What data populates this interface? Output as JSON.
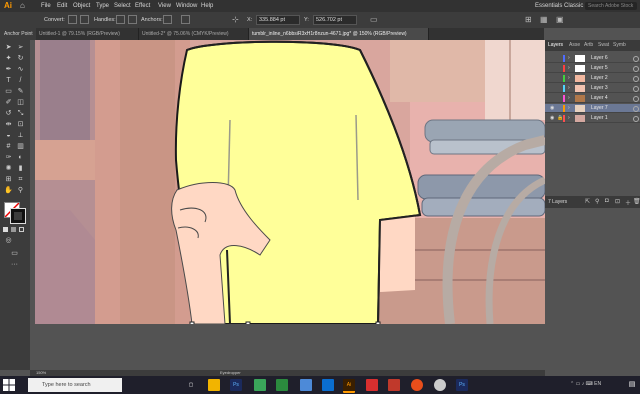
{
  "app": {
    "logo": "Ai",
    "home_icon": "home-icon"
  },
  "menu": [
    "File",
    "Edit",
    "Object",
    "Type",
    "Select",
    "Effect",
    "View",
    "Window",
    "Help"
  ],
  "workspace": "Essentials Classic",
  "search_placeholder": "Search Adobe Stock",
  "control_bar": {
    "convert_label": "Convert:",
    "handles_label": "Handles:",
    "anchors_label": "Anchors:",
    "x_value": "335.884 pt",
    "y_value": "526.702 pt"
  },
  "tool_label": "Anchor Point",
  "tabs": [
    "Untitled-1 @ 79.15% (RGB/Preview)",
    "Untitled-2* @ 75.06% (CMYK/Preview)",
    "tumblr_inline_n6bbsiR3xH1r8nzun-4671.jpg* @ 150% (RGB/Preview)"
  ],
  "layers_panel": {
    "tabs": [
      "Layers",
      "Asse",
      "Artb",
      "Swat",
      "Symb"
    ],
    "layers": [
      {
        "name": "Layer 6",
        "color": "#4f6cff"
      },
      {
        "name": "Layer 5",
        "color": "#ff3f3f"
      },
      {
        "name": "Layer 2",
        "color": "#3fd43f"
      },
      {
        "name": "Layer 3",
        "color": "#4fd4ff"
      },
      {
        "name": "Layer 4",
        "color": "#ff4fd8"
      },
      {
        "name": "Layer 7",
        "color": "#ff9a00"
      },
      {
        "name": "Layer 1",
        "color": "#ff4f4f"
      }
    ],
    "footer_count": "7 Layers"
  },
  "status": {
    "zoom": "150%",
    "tool": "Eyedropper"
  },
  "taskbar": {
    "search_placeholder": "Type here to search",
    "time": "",
    "apps": [
      "file-explorer",
      "photoshop",
      "media",
      "spotify",
      "illustrator",
      "chrome"
    ]
  }
}
